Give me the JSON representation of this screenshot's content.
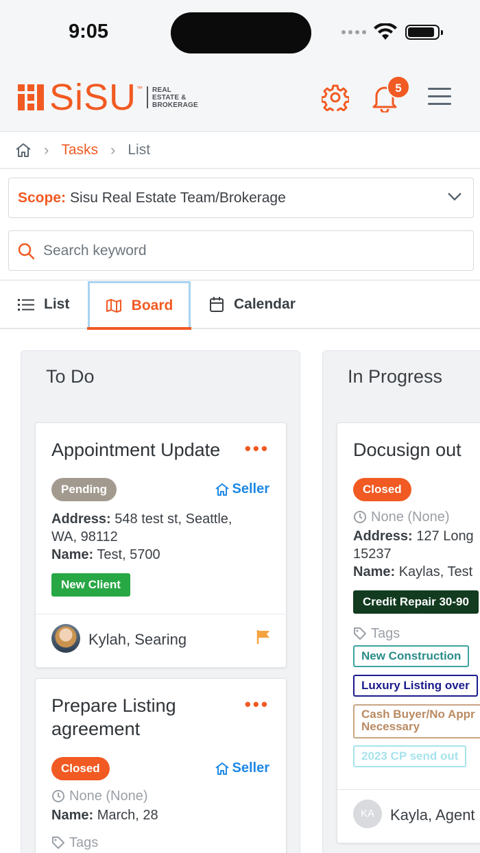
{
  "status_bar": {
    "time": "9:05"
  },
  "header": {
    "logo_text": "SiSU",
    "logo_sub": "REAL ESTATE & BROKERAGE",
    "notification_count": "5"
  },
  "breadcrumb": {
    "items": [
      "Tasks",
      "List"
    ]
  },
  "scope": {
    "label": "Scope:",
    "value": "Sisu Real Estate Team/Brokerage"
  },
  "search": {
    "placeholder": "Search keyword"
  },
  "view_tabs": [
    {
      "label": "List",
      "active": false
    },
    {
      "label": "Board",
      "active": true
    },
    {
      "label": "Calendar",
      "active": false
    }
  ],
  "board": {
    "columns": [
      {
        "title": "To Do",
        "cards": [
          {
            "title": "Appointment Update",
            "status": "Pending",
            "side": "Seller",
            "address_label": "Address:",
            "address": "548 test st, Seattle,",
            "address_2": "WA, 98112",
            "name_label": "Name:",
            "name": "Test, 5700",
            "tag": "New Client",
            "assignee": "Kylah, Searing"
          },
          {
            "title_1": "Prepare Listing",
            "title_2": "agreement",
            "status": "Closed",
            "side": "Seller",
            "due": "None (None)",
            "name_label": "Name:",
            "name": "March, 28",
            "tags_label": "Tags"
          }
        ]
      },
      {
        "title": "In Progress",
        "cards": [
          {
            "title": "Docusign out",
            "status": "Closed",
            "due": "None (None)",
            "address_label": "Address:",
            "address": "127 Long",
            "address_2": "15237",
            "name_label": "Name:",
            "name": "Kaylas, Test",
            "tag": "Credit Repair 30-90",
            "tags_label": "Tags",
            "tags": [
              "New Construction",
              "Luxury Listing over",
              "Cash Buyer/No Appr Necessary",
              "2023 CP send out"
            ],
            "assignee_initials": "KA",
            "assignee": "Kayla, Agent"
          }
        ]
      }
    ]
  },
  "colors": {
    "accent": "#f15a22",
    "link": "#1e88e5",
    "pending": "#a39a8f",
    "success": "#28a745"
  }
}
